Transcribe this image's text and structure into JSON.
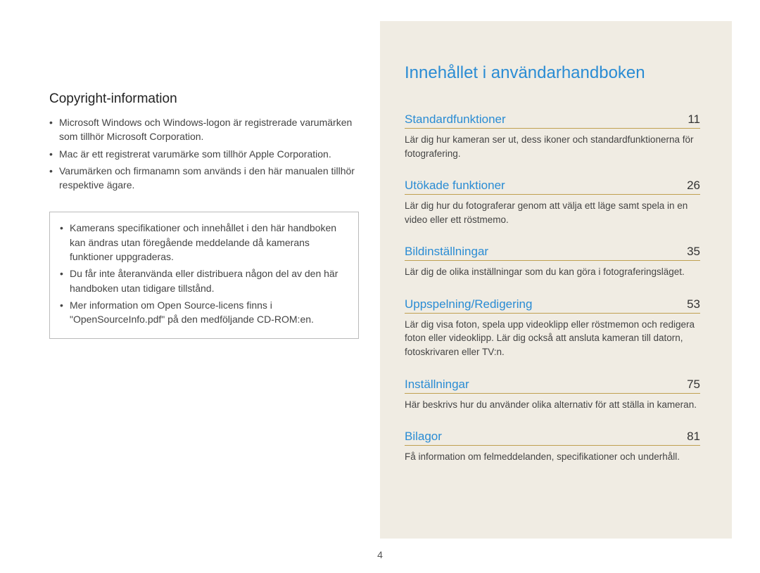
{
  "pageNumber": "4",
  "left": {
    "heading": "Copyright-information",
    "bullets": [
      "Microsoft Windows och Windows-logon är registrerade varumärken som tillhör Microsoft Corporation.",
      "Mac är ett registrerat varumärke som tillhör Apple Corporation.",
      "Varumärken och firmanamn som används i den här manualen tillhör respektive ägare."
    ],
    "boxBullets": [
      "Kamerans specifikationer och innehållet i den här handboken kan ändras utan föregående meddelande då kamerans funktioner uppgraderas.",
      "Du får inte återanvända eller distribuera någon del av den här handboken utan tidigare tillstånd.",
      "Mer information om Open Source-licens finns i \"OpenSourceInfo.pdf\" på den medföljande CD-ROM:en."
    ]
  },
  "right": {
    "title": "Innehållet i användarhandboken",
    "entries": [
      {
        "label": "Standardfunktioner",
        "page": "11",
        "desc": "Lär dig hur kameran ser ut, dess ikoner och standardfunktionerna för fotografering."
      },
      {
        "label": "Utökade funktioner",
        "page": "26",
        "desc": "Lär dig hur du fotograferar genom att välja ett läge samt spela in en video eller ett röstmemo."
      },
      {
        "label": "Bildinställningar",
        "page": "35",
        "desc": "Lär dig de olika inställningar som du kan göra i fotograferingsläget."
      },
      {
        "label": "Uppspelning/Redigering",
        "page": "53",
        "desc": "Lär dig visa foton, spela upp videoklipp eller röstmemon och redigera foton eller videoklipp. Lär dig också att ansluta kameran till datorn, fotoskrivaren eller TV:n."
      },
      {
        "label": "Inställningar",
        "page": "75",
        "desc": "Här beskrivs hur du använder olika alternativ för att ställa in kameran."
      },
      {
        "label": "Bilagor",
        "page": "81",
        "desc": "Få information om felmeddelanden, specifikationer och underhåll."
      }
    ]
  }
}
